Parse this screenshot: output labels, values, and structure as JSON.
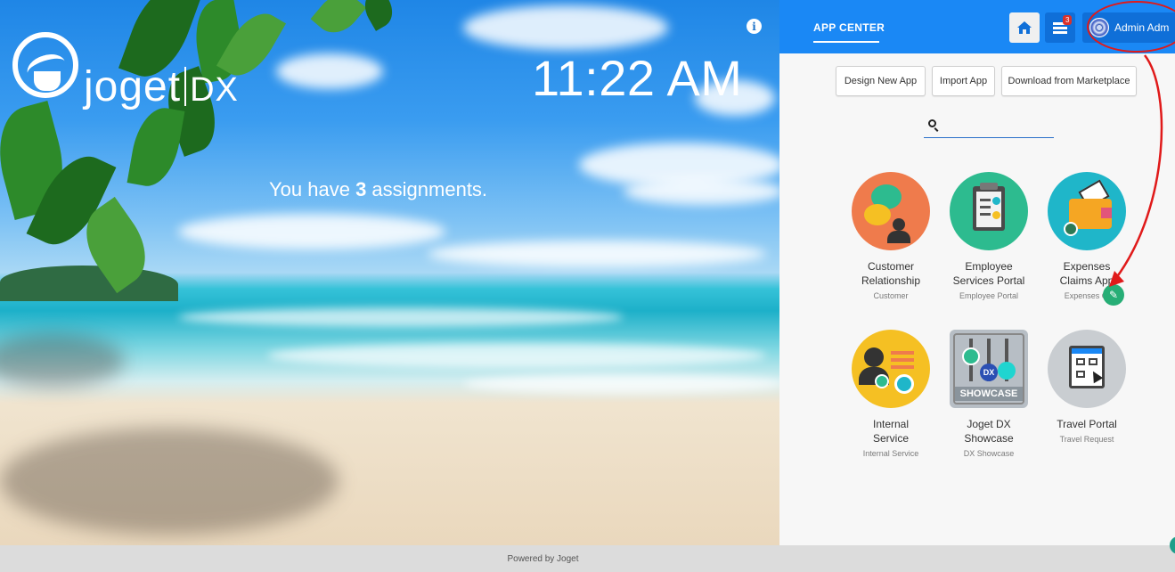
{
  "hero": {
    "logo_text": "joget",
    "logo_dx": "DX",
    "clock": "11:22 AM",
    "assign_prefix": "You have ",
    "assign_count": "3",
    "assign_suffix": " assignments.",
    "info_icon": "info-icon"
  },
  "topbar": {
    "title": "APP CENTER",
    "home_icon": "home-icon",
    "inbox_icon": "inbox-icon",
    "inbox_badge": "3",
    "user_name": "Admin Adm"
  },
  "actions": [
    {
      "label": "Design New App"
    },
    {
      "label": "Import App"
    },
    {
      "label": "Download from Marketplace"
    }
  ],
  "search": {
    "value": "",
    "placeholder": ""
  },
  "apps": [
    {
      "title_1": "Customer",
      "title_2": "Relationship",
      "sub": "Customer",
      "color": "#ef7b4c"
    },
    {
      "title_1": "Employee",
      "title_2": "Services Portal",
      "sub": "Employee Portal",
      "color": "#2dbb8f"
    },
    {
      "title_1": "Expenses",
      "title_2": "Claims App",
      "sub": "Expenses Cl",
      "color": "#1fb6c9"
    },
    {
      "title_1": "Internal",
      "title_2": "Service",
      "sub": "Internal Service",
      "color": "#f5c023"
    },
    {
      "title_1": "Joget DX",
      "title_2": "Showcase",
      "sub": "DX Showcase",
      "color": "#b7bec5",
      "badge": "SHOWCASE"
    },
    {
      "title_1": "Travel Portal",
      "title_2": "",
      "sub": "Travel Request",
      "color": "#c9cdd1"
    }
  ],
  "footer": {
    "text": "Powered by Joget"
  },
  "colors": {
    "topbar": "#1a88f5",
    "annotation": "#e01a1a",
    "edit": "#27ae76"
  }
}
